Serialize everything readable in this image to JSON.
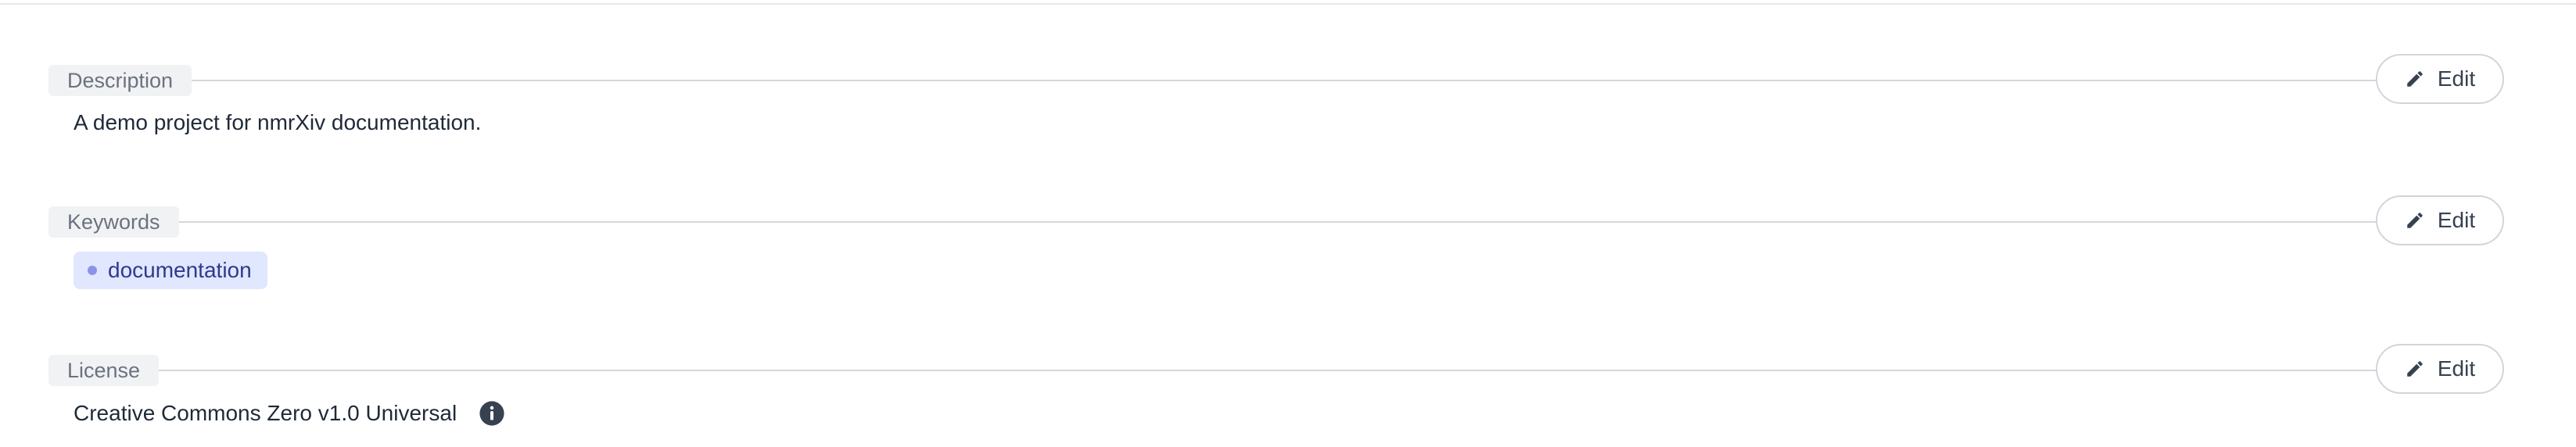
{
  "sections": {
    "description": {
      "label": "Description",
      "edit_label": "Edit",
      "text": "A demo project for nmrXiv documentation."
    },
    "keywords": {
      "label": "Keywords",
      "edit_label": "Edit",
      "items": [
        "documentation"
      ]
    },
    "license": {
      "label": "License",
      "edit_label": "Edit",
      "text": "Creative Commons Zero v1.0 Universal",
      "info_icon": "info-circle-icon"
    }
  },
  "colors": {
    "label_bg": "#f1f2f4",
    "chip_bg": "#e0e7ff",
    "chip_text": "#2e3a8c",
    "divider": "#d4d7dc"
  }
}
